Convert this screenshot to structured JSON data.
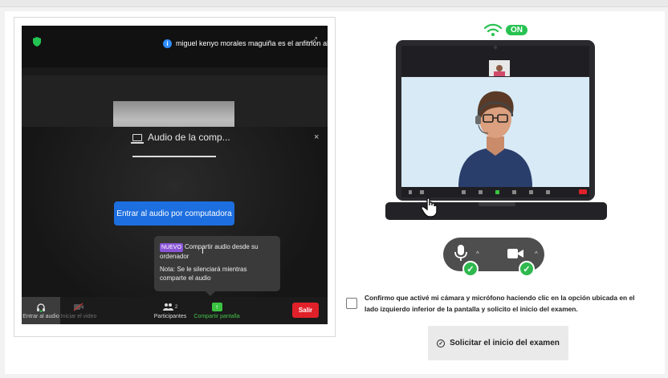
{
  "zoom": {
    "host_notice": "miguel kenyo morales maguiña es el anfitrión ahor",
    "audio_panel_title": "Audio de la comp...",
    "join_audio_button": "Entrar al audio por computadora",
    "tooltip": {
      "badge": "NUEVO",
      "headline": "Compartir audio desde su ordenador",
      "note": "Nota: Se le silenciará mientras comparte el audio"
    },
    "toolbar": {
      "mic_label": "Entrar al audio",
      "video_label": "Iniciar el video",
      "participants_label": "Participantes",
      "participants_count": "2",
      "share_label": "Compartir pantalla",
      "leave_label": "Salir"
    }
  },
  "illustration": {
    "status_badge": "ON",
    "icons": [
      "wifi-icon",
      "laptop-icon",
      "hand-cursor-icon",
      "microphone-icon",
      "camera-icon",
      "check-icon"
    ],
    "colors": {
      "on_green": "#27c251",
      "check_green": "#2fb84e",
      "pill_gray": "#4e4e4e"
    }
  },
  "confirmation": {
    "checkbox_checked": false,
    "text": "Confirmo que activé mi cámara y micrófono haciendo clic en la opción ubicada en el lado izquierdo inferior de la pantalla y solicito el inicio del examen."
  },
  "request_button": {
    "label": "Solicitar el inicio del examen"
  },
  "colors": {
    "zoom_blue": "#1d6fe0",
    "leave_red": "#e0212a",
    "share_green": "#43c24a"
  }
}
